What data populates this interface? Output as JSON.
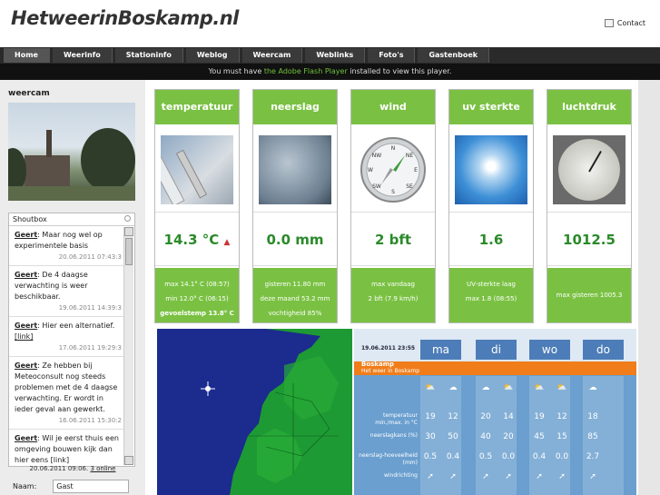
{
  "header": {
    "logo": "HetweerinBoskamp.nl",
    "contact": "Contact"
  },
  "nav": [
    "Home",
    "Weerinfo",
    "Stationinfo",
    "Weblog",
    "Weercam",
    "Weblinks",
    "Foto's",
    "Gastenboek"
  ],
  "flash": {
    "pre": "You must have ",
    "link": "the Adobe Flash Player",
    "post": " installed to view this player."
  },
  "sidebar": {
    "webcam_title": "weercam",
    "shoutbox_title": "Shoutbox",
    "messages": [
      {
        "author": "Geert",
        "text": ": Maar nog wel op experimentele basis",
        "time": "20.06.2011 07:43:3"
      },
      {
        "author": "Geert",
        "text": ": De 4 daagse verwachting is weer beschikbaar.",
        "time": "19.06.2011 14:39:3"
      },
      {
        "author": "Geert",
        "text": ": Hier een alternatief.",
        "link": "[link]",
        "time": "17.06.2011 19:29:3"
      },
      {
        "author": "Geert",
        "text": ": Ze hebben bij Meteoconsult nog steeds problemen met de 4 daagse verwachting. Er wordt in ieder geval aan gewerkt.",
        "time": "16.06.2011 15:30:2"
      },
      {
        "author": "Geert",
        "text": ": Wil je eerst thuis een omgeving bouwen kijk dan hier eens [link]",
        "time": ""
      }
    ],
    "footer": {
      "date": "20.06.2011 09:06.",
      "online": "3 online"
    },
    "name_label": "Naam:",
    "name_value": "Gast"
  },
  "cards": [
    {
      "title": "temperatuur",
      "value": "14.3 °C",
      "lines": [
        "max 14.1° C (08:57)",
        "min 12.0° C (06:15)"
      ],
      "bold": "gevoelstemp 13.8° C"
    },
    {
      "title": "neerslag",
      "value": "0.0 mm",
      "lines": [
        "gisteren 11.80 mm",
        "deze maand 53.2 mm",
        "vochtigheid 85%"
      ],
      "bold": ""
    },
    {
      "title": "wind",
      "value": "2 bft",
      "lines": [
        "max vandaag",
        "2 bft (7.9 km/h)"
      ],
      "bold": ""
    },
    {
      "title": "uv sterkte",
      "value": "1.6",
      "lines": [
        "UV-sterkte laag",
        "max 1.8 (08:55)"
      ],
      "bold": ""
    },
    {
      "title": "luchtdruk",
      "value": "1012.5",
      "lines": [
        "max gisteren 1005.3"
      ],
      "bold": ""
    }
  ],
  "forecast": {
    "date": "19.06.2011",
    "time": "23:55",
    "days": [
      "ma",
      "di",
      "wo",
      "do"
    ],
    "location": "Boskamp",
    "subtitle": "Het weer in Boskamp",
    "labels": [
      "temperatuur min./max. in °C",
      "neerslagkans (%)",
      "neerslag-hoeveelheid (mm)",
      "windrichting"
    ],
    "temps": [
      [
        "19",
        "12"
      ],
      [
        "20",
        "14"
      ],
      [
        "19",
        "12"
      ],
      [
        "18",
        ""
      ]
    ],
    "rain_chance": [
      [
        "30",
        "50"
      ],
      [
        "40",
        "20"
      ],
      [
        "45",
        "15"
      ],
      [
        "85",
        ""
      ]
    ],
    "rain_amount": [
      [
        "0.5",
        "0.4"
      ],
      [
        "0.5",
        "0.0"
      ],
      [
        "0.4",
        "0.0"
      ],
      [
        "2.7",
        ""
      ]
    ],
    "compass": [
      "NW",
      "N",
      "NE",
      "W",
      "E",
      "SW",
      "S",
      "SE"
    ]
  }
}
